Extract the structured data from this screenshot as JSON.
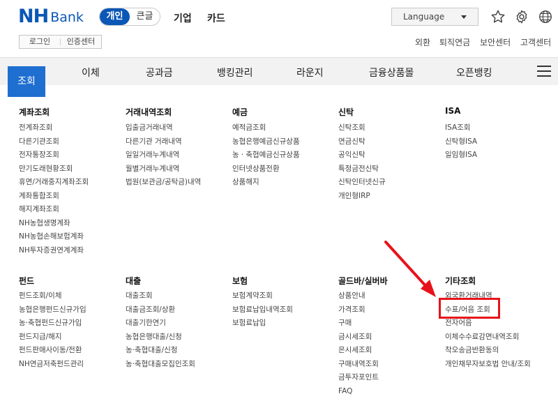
{
  "brand": {
    "nh": "NH",
    "bank": "Bank"
  },
  "segment": {
    "personal": "개인",
    "big": "큰글"
  },
  "top_links": [
    "기업",
    "카드"
  ],
  "language": {
    "label": "Language"
  },
  "login": {
    "login": "로그인",
    "cert": "인증센터"
  },
  "utility": [
    "외환",
    "퇴직연금",
    "보안센터",
    "고객센터"
  ],
  "gnb": {
    "active": "조회",
    "items": [
      "이체",
      "공과금",
      "뱅킹관리",
      "라운지",
      "금융상품몰",
      "오픈뱅킹"
    ]
  },
  "columns_row1": [
    {
      "title": "계좌조회",
      "items": [
        "전계좌조회",
        "다른기관조회",
        "전자통장조회",
        "만기도래현황조회",
        "휴면/거래중지계좌조회",
        "계좌통합조회",
        "해지계좌조회",
        "NH농협생명계좌",
        "NH농협손해보험계좌",
        "NH투자증권연계계좌"
      ]
    },
    {
      "title": "거래내역조회",
      "items": [
        "입출금거래내역",
        "다른기관 거래내역",
        "일일거래누계내역",
        "월별거래누계내역",
        "법원(보관금/공탁금)내역"
      ]
    },
    {
      "title": "예금",
      "items": [
        "예적금조회",
        "농협은행예금신규상품",
        "농ㆍ축협예금신규상품",
        "인터넷상품전환",
        "상품해지"
      ]
    },
    {
      "title": "신탁",
      "items": [
        "신탁조회",
        "연금신탁",
        "공익신탁",
        "특정금전신탁",
        "신탁인터넷신규",
        "개인형IRP"
      ]
    },
    {
      "title": "ISA",
      "items": [
        "ISA조회",
        "신탁형ISA",
        "일임형ISA"
      ]
    }
  ],
  "columns_row2": [
    {
      "title": "펀드",
      "items": [
        "펀드조회/이체",
        "농협은행펀드신규가입",
        "농·축협펀드신규가입",
        "펀드지급/해지",
        "펀드판매사이동/전환",
        "NH연금저축펀드관리"
      ]
    },
    {
      "title": "대출",
      "items": [
        "대출조회",
        "대출금조회/상환",
        "대출기한연기",
        "농협은행대출/신청",
        "농·축협대출/신청",
        "농·축협대출모집인조회"
      ]
    },
    {
      "title": "보험",
      "items": [
        "보험계약조회",
        "보험료납입내역조회",
        "보험료납입"
      ]
    },
    {
      "title": "골드바/실버바",
      "items": [
        "상품안내",
        "가격조회",
        "구매",
        "금시세조회",
        "은시세조회",
        "구매내역조회",
        "금투자포인트",
        "FAQ"
      ]
    },
    {
      "title": "기타조회",
      "items": [
        "외국환거래내역",
        "수표/어음 조회",
        "전자어음",
        "이체수수료감면내역조회",
        "착오송금반환동의",
        "개인채무자보호법 안내/조회"
      ]
    }
  ],
  "colors": {
    "brand": "#0b57b5",
    "gnb_active": "#1f6fd1",
    "annotation": "#e8121a"
  },
  "icons": [
    "star-icon",
    "gear-icon",
    "globe-icon",
    "hamburger-icon",
    "caret-down-icon"
  ]
}
